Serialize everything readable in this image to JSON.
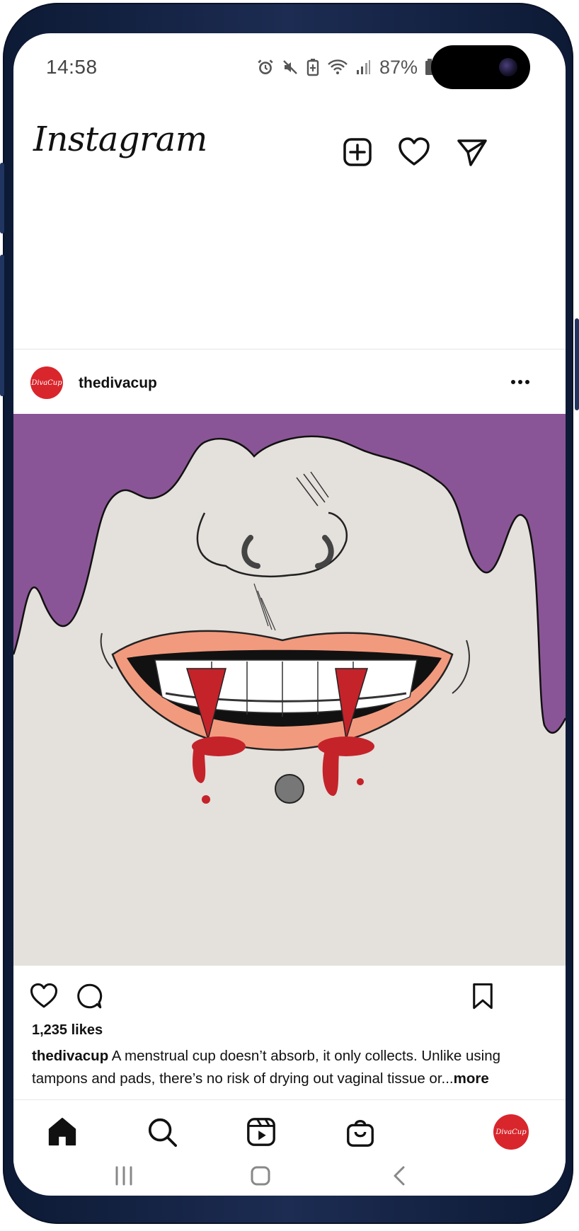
{
  "status_bar": {
    "time": "14:58",
    "battery": "87%",
    "icons": [
      "alarm-icon",
      "mute-icon",
      "battery-saver-icon",
      "wifi-icon",
      "signal-icon",
      "battery-icon"
    ]
  },
  "header": {
    "logo": "Instagram",
    "icons": [
      "add-post-icon",
      "heart-icon",
      "send-icon"
    ]
  },
  "post": {
    "username": "thedivacup",
    "avatar_text": "DivaCup",
    "likes": "1,235 likes",
    "caption_user": "thedivacup",
    "caption_text": " A menstrual cup doesn’t absorb, it only collects. Unlike using tampons and pads, there’s no risk of drying out vaginal tissue or...",
    "caption_more": "more",
    "image_subject": "illustration of a mouth with nose rings, fangs and blood drips on purple dripping background"
  },
  "bottom_nav": {
    "items": [
      "home-icon",
      "search-icon",
      "reels-icon",
      "shop-icon",
      "profile-avatar"
    ],
    "avatar_text": "DivaCup"
  },
  "system_nav": {
    "items": [
      "recents-icon",
      "home-button-icon",
      "back-icon"
    ]
  },
  "colors": {
    "brand_red": "#d8262c",
    "purple": "#8a5596",
    "frame": "#15244a"
  }
}
